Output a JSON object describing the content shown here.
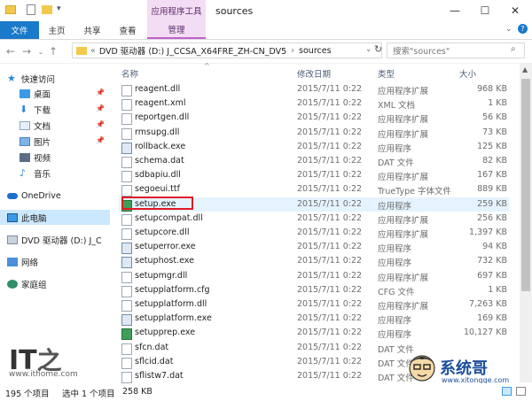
{
  "window": {
    "title": "sources",
    "context_tab": "应用程序工具",
    "controls": [
      "—",
      "☐",
      "✕"
    ]
  },
  "ribbon": {
    "tabs": [
      "文件",
      "主页",
      "共享",
      "查看",
      "管理"
    ]
  },
  "nav": {
    "address": "DVD 驱动器 (D:) J_CCSA_X64FRE_ZH-CN_DV5",
    "address_tail": "sources",
    "search_placeholder": "搜索\"sources\""
  },
  "sidebar": {
    "items": [
      {
        "label": "快速访问",
        "icon": "star-icon"
      },
      {
        "label": "桌面",
        "icon": "desktop-icon",
        "pinned": true
      },
      {
        "label": "下载",
        "icon": "download-icon",
        "pinned": true
      },
      {
        "label": "文档",
        "icon": "document-icon",
        "pinned": true
      },
      {
        "label": "图片",
        "icon": "picture-icon",
        "pinned": true
      },
      {
        "label": "视频",
        "icon": "video-icon"
      },
      {
        "label": "音乐",
        "icon": "music-icon"
      },
      {
        "label": "OneDrive",
        "icon": "cloud-icon"
      },
      {
        "label": "此电脑",
        "icon": "computer-icon"
      },
      {
        "label": "DVD 驱动器 (D:) J_C",
        "icon": "dvd-icon"
      },
      {
        "label": "网络",
        "icon": "network-icon"
      },
      {
        "label": "家庭组",
        "icon": "homegroup-icon"
      }
    ]
  },
  "columns": [
    "名称",
    "修改日期",
    "类型",
    "大小"
  ],
  "files": [
    {
      "name": "reagent.dll",
      "date": "2015/7/11 0:22",
      "type": "应用程序扩展",
      "size": "968 KB",
      "icon": "dll"
    },
    {
      "name": "reagent.xml",
      "date": "2015/7/11 0:22",
      "type": "XML 文档",
      "size": "1 KB",
      "icon": "xml"
    },
    {
      "name": "reportgen.dll",
      "date": "2015/7/11 0:22",
      "type": "应用程序扩展",
      "size": "56 KB",
      "icon": "dll"
    },
    {
      "name": "rmsupg.dll",
      "date": "2015/7/11 0:22",
      "type": "应用程序扩展",
      "size": "73 KB",
      "icon": "dll"
    },
    {
      "name": "rollback.exe",
      "date": "2015/7/11 0:22",
      "type": "应用程序",
      "size": "125 KB",
      "icon": "exe"
    },
    {
      "name": "schema.dat",
      "date": "2015/7/11 0:22",
      "type": "DAT 文件",
      "size": "82 KB",
      "icon": "dat"
    },
    {
      "name": "sdbapiu.dll",
      "date": "2015/7/11 0:22",
      "type": "应用程序扩展",
      "size": "167 KB",
      "icon": "dll"
    },
    {
      "name": "segoeui.ttf",
      "date": "2015/7/11 0:22",
      "type": "TrueType 字体文件",
      "size": "889 KB",
      "icon": "font"
    },
    {
      "name": "setup.exe",
      "date": "2015/7/11 0:22",
      "type": "应用程序",
      "size": "259 KB",
      "icon": "setup"
    },
    {
      "name": "setupcompat.dll",
      "date": "2015/7/11 0:22",
      "type": "应用程序扩展",
      "size": "256 KB",
      "icon": "dll"
    },
    {
      "name": "setupcore.dll",
      "date": "2015/7/11 0:22",
      "type": "应用程序扩展",
      "size": "1,397 KB",
      "icon": "dll"
    },
    {
      "name": "setuperror.exe",
      "date": "2015/7/11 0:22",
      "type": "应用程序",
      "size": "94 KB",
      "icon": "exe"
    },
    {
      "name": "setuphost.exe",
      "date": "2015/7/11 0:22",
      "type": "应用程序",
      "size": "732 KB",
      "icon": "exe"
    },
    {
      "name": "setupmgr.dll",
      "date": "2015/7/11 0:22",
      "type": "应用程序扩展",
      "size": "697 KB",
      "icon": "dll"
    },
    {
      "name": "setupplatform.cfg",
      "date": "2015/7/11 0:22",
      "type": "CFG 文件",
      "size": "1 KB",
      "icon": "dat"
    },
    {
      "name": "setupplatform.dll",
      "date": "2015/7/11 0:22",
      "type": "应用程序扩展",
      "size": "7,263 KB",
      "icon": "dll"
    },
    {
      "name": "setupplatform.exe",
      "date": "2015/7/11 0:22",
      "type": "应用程序",
      "size": "169 KB",
      "icon": "exe"
    },
    {
      "name": "setupprep.exe",
      "date": "2015/7/11 0:22",
      "type": "应用程序",
      "size": "10,127 KB",
      "icon": "setup"
    },
    {
      "name": "sfcn.dat",
      "date": "2015/7/11 0:22",
      "type": "DAT 文件",
      "size": "",
      "icon": "dat"
    },
    {
      "name": "sflcid.dat",
      "date": "2015/7/11 0:22",
      "type": "DAT 文件",
      "size": "",
      "icon": "dat"
    },
    {
      "name": "sflistw7.dat",
      "date": "2015/7/11 0:22",
      "type": "DAT 文件",
      "size": "",
      "icon": "dat"
    }
  ],
  "selected_file": "setup.exe",
  "status": {
    "count": "195 个项目",
    "selected": "选中 1 个项目",
    "size": "258 KB"
  },
  "watermarks": {
    "it_logo": "IT之家",
    "it_url": "www.ithome.com",
    "xt_logo": "系统哥",
    "xt_url": "www.xitongge.com"
  },
  "colors": {
    "file_tab": "#1979ca",
    "manage_tab": "#f3ddf4",
    "selection": "#cce8ff",
    "highlight_border": "#e01b24"
  }
}
